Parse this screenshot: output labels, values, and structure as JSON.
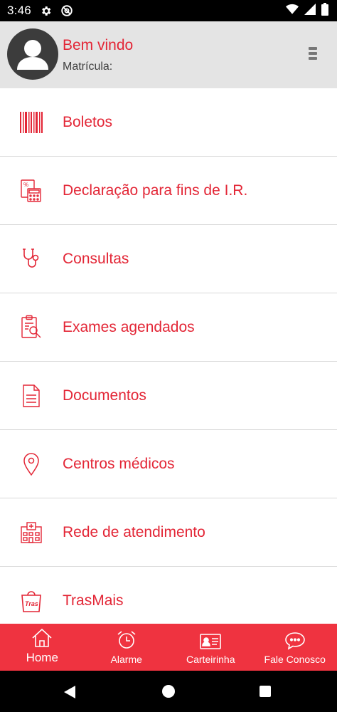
{
  "status_bar": {
    "time": "3:46",
    "icons": [
      "gear-icon",
      "at-sign-icon",
      "wifi-icon",
      "signal-icon",
      "battery-icon"
    ]
  },
  "header": {
    "welcome": "Bem vindo",
    "registration_label": "Matrícula:",
    "avatar_icon": "user-avatar-icon",
    "menu_icon": "menu-icon"
  },
  "menu": {
    "items": [
      {
        "label": "Boletos",
        "icon": "barcode-icon"
      },
      {
        "label": "Declaração para fins de I.R.",
        "icon": "calculator-icon"
      },
      {
        "label": "Consultas",
        "icon": "stethoscope-icon"
      },
      {
        "label": "Exames agendados",
        "icon": "clipboard-search-icon"
      },
      {
        "label": "Documentos",
        "icon": "document-icon"
      },
      {
        "label": "Centros médicos",
        "icon": "location-pin-icon"
      },
      {
        "label": "Rede de atendimento",
        "icon": "hospital-icon"
      },
      {
        "label": "TrasMais",
        "icon": "trasmais-bag-icon"
      }
    ]
  },
  "bottom_nav": {
    "tabs": [
      {
        "label": "Home",
        "icon": "home-icon",
        "active": true
      },
      {
        "label": "Alarme",
        "icon": "alarm-clock-icon"
      },
      {
        "label": "Carteirinha",
        "icon": "id-card-icon"
      },
      {
        "label": "Fale Conosco",
        "icon": "chat-bubble-icon"
      }
    ]
  },
  "colors": {
    "accent": "#e32636",
    "nav_bar": "#ef3340",
    "header_bg": "#e4e4e4",
    "status_bar": "#000000"
  }
}
